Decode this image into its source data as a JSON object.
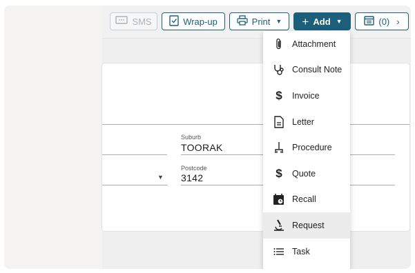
{
  "toolbar": {
    "sms_label": "SMS",
    "wrapup_label": "Wrap-up",
    "print_label": "Print",
    "add_label": "Add",
    "calendar_label": "(0)"
  },
  "form": {
    "suburb": {
      "label": "Suburb",
      "value": "TOORAK"
    },
    "postcode": {
      "label": "Postcode",
      "value": "3142"
    }
  },
  "add_menu": {
    "items": [
      {
        "label": "Attachment",
        "icon": "paperclip-icon"
      },
      {
        "label": "Consult Note",
        "icon": "stethoscope-icon"
      },
      {
        "label": "Invoice",
        "icon": "dollar-icon"
      },
      {
        "label": "Letter",
        "icon": "document-icon"
      },
      {
        "label": "Procedure",
        "icon": "procedure-icon"
      },
      {
        "label": "Quote",
        "icon": "dollar-icon"
      },
      {
        "label": "Recall",
        "icon": "calendar-clock-icon"
      },
      {
        "label": "Request",
        "icon": "microscope-icon"
      },
      {
        "label": "Task",
        "icon": "list-icon"
      }
    ],
    "highlighted": "Request"
  },
  "colors": {
    "accent": "#1b5f7a",
    "disabled": "#aab1b6"
  }
}
